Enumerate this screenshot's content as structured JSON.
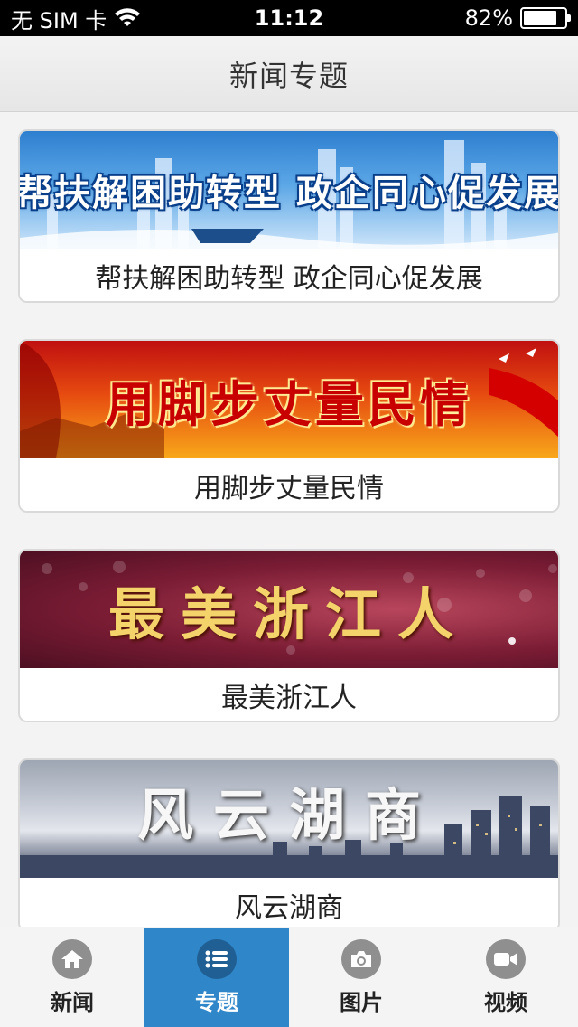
{
  "status_bar": {
    "carrier": "无 SIM 卡",
    "time": "11:12",
    "battery_text": "82%",
    "battery_level": 0.82
  },
  "nav": {
    "title": "新闻专题"
  },
  "topics": [
    {
      "banner_text": "帮扶解困助转型  政企同心促发展",
      "caption": "帮扶解困助转型 政企同心促发展"
    },
    {
      "banner_text": "用脚步丈量民情",
      "caption": "用脚步丈量民情"
    },
    {
      "banner_text": "最美浙江人",
      "caption": "最美浙江人"
    },
    {
      "banner_text": "风云湖商",
      "caption": "风云湖商"
    }
  ],
  "tabs": [
    {
      "label": "新闻",
      "icon": "home-icon",
      "active": false
    },
    {
      "label": "专题",
      "icon": "list-icon",
      "active": true
    },
    {
      "label": "图片",
      "icon": "camera-icon",
      "active": false
    },
    {
      "label": "视频",
      "icon": "video-icon",
      "active": false
    }
  ],
  "colors": {
    "tab_active": "#2f86c9",
    "status_bar": "#000000"
  }
}
